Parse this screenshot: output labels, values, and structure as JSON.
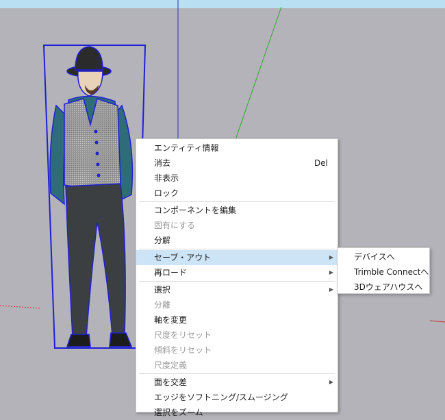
{
  "context_menu": {
    "items": [
      {
        "label": "エンティティ情報",
        "disabled": false
      },
      {
        "label": "消去",
        "shortcut": "Del",
        "disabled": false
      },
      {
        "label": "非表示",
        "disabled": false
      },
      {
        "label": "ロック",
        "disabled": false
      },
      {
        "label": "コンポーネントを編集",
        "disabled": false
      },
      {
        "label": "固有にする",
        "disabled": true
      },
      {
        "label": "分解",
        "disabled": false
      },
      {
        "label": "セーブ・アウト",
        "disabled": false,
        "submenu": true,
        "highlighted": true
      },
      {
        "label": "再ロード",
        "disabled": false,
        "submenu": true
      },
      {
        "label": "選択",
        "disabled": false,
        "submenu": true
      },
      {
        "label": "分離",
        "disabled": true
      },
      {
        "label": "軸を変更",
        "disabled": false
      },
      {
        "label": "尺度をリセット",
        "disabled": true
      },
      {
        "label": "傾斜をリセット",
        "disabled": true
      },
      {
        "label": "尺度定義",
        "disabled": true
      },
      {
        "label": "面を交差",
        "disabled": false,
        "submenu": true
      },
      {
        "label": "エッジをソフトニング/スムージング",
        "disabled": false
      },
      {
        "label": "選択をズーム",
        "disabled": false
      }
    ]
  },
  "submenu": {
    "items": [
      {
        "label": "デバイスへ"
      },
      {
        "label": "Trimble Connectへ"
      },
      {
        "label": "3Dウェアハウスへ"
      }
    ]
  },
  "colors": {
    "background": "#b3b3b9",
    "sky": "#b9e0f2",
    "blue_axis": "#2a2ad0",
    "green_axis": "#2fa82f",
    "red_axis": "#c83232",
    "selection_box": "#1f1fd6",
    "menu_highlight": "#cde4f7"
  },
  "icons": {
    "submenu_arrow": "submenu-arrow-icon"
  }
}
